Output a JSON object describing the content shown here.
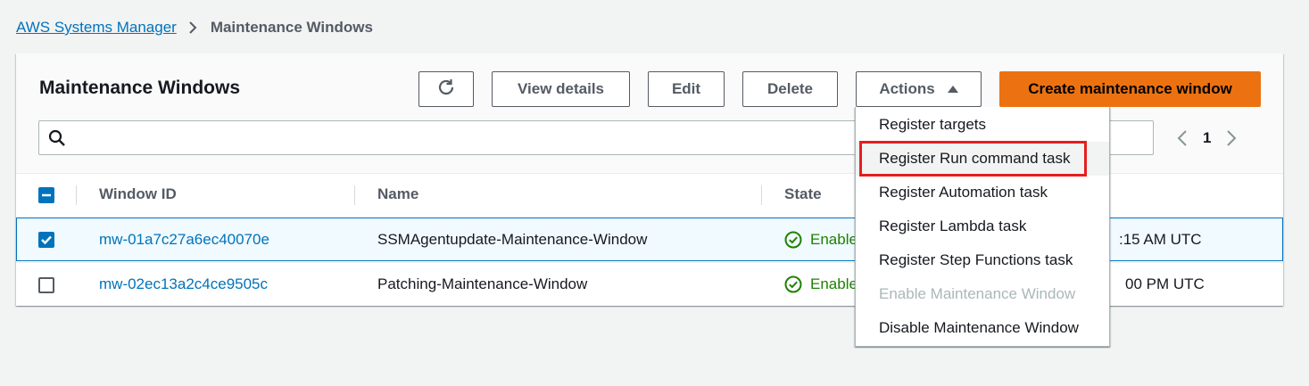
{
  "breadcrumb": {
    "root": "AWS Systems Manager",
    "current": "Maintenance Windows"
  },
  "panel": {
    "title": "Maintenance Windows"
  },
  "toolbar": {
    "refresh_icon": "refresh-icon",
    "view_details": "View details",
    "edit": "Edit",
    "delete": "Delete",
    "actions": "Actions",
    "create": "Create maintenance window"
  },
  "search": {
    "value": "",
    "placeholder": ""
  },
  "pagination": {
    "current_page": "1"
  },
  "table": {
    "columns": [
      "Window ID",
      "Name",
      "State"
    ],
    "rows": [
      {
        "selected": true,
        "window_id": "mw-01a7c27a6ec40070e",
        "name": "SSMAgentupdate-Maintenance-Window",
        "state": "Enabled",
        "next_execution_partial": ":15 AM UTC"
      },
      {
        "selected": false,
        "window_id": "mw-02ec13a2c4ce9505c",
        "name": "Patching-Maintenance-Window",
        "state": "Enabled",
        "next_execution_partial": "00 PM UTC"
      }
    ]
  },
  "actions_menu": {
    "items": [
      {
        "label": "Register targets",
        "disabled": false
      },
      {
        "label": "Register Run command task",
        "disabled": false,
        "highlighted": true
      },
      {
        "label": "Register Automation task",
        "disabled": false
      },
      {
        "label": "Register Lambda task",
        "disabled": false
      },
      {
        "label": "Register Step Functions task",
        "disabled": false
      },
      {
        "label": "Enable Maintenance Window",
        "disabled": true
      },
      {
        "label": "Disable Maintenance Window",
        "disabled": false
      }
    ]
  },
  "colors": {
    "link": "#0073bb",
    "primary": "#ec7211",
    "success": "#1d8102",
    "highlight_box": "#e61e1e"
  }
}
